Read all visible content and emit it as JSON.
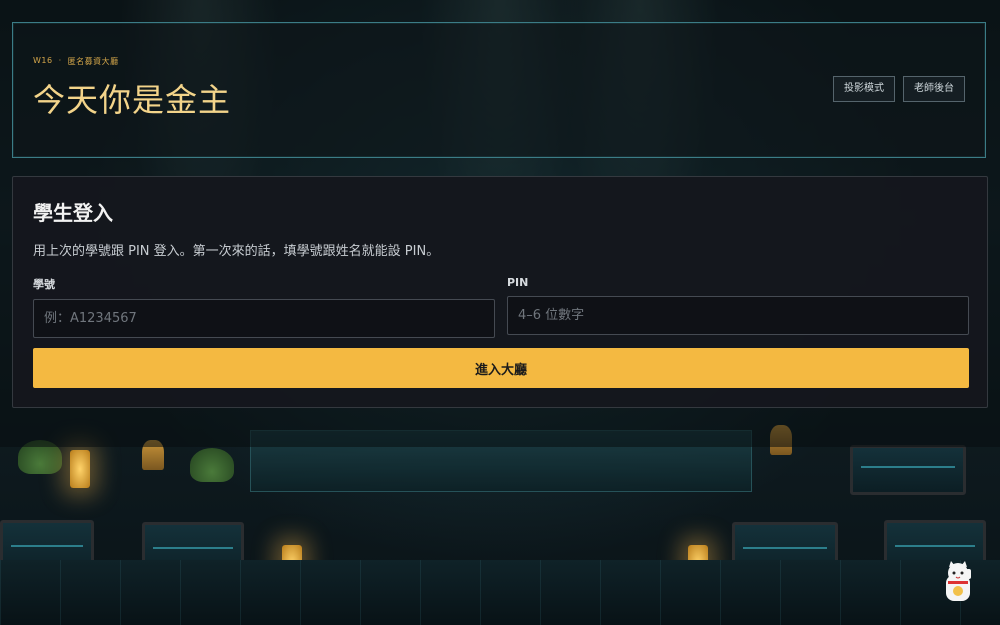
{
  "header": {
    "week": "W16",
    "separator": "·",
    "event": "匿名募資大廳",
    "title": "今天你是金主",
    "buttons": {
      "projection": "投影模式",
      "teacher": "老師後台"
    }
  },
  "login": {
    "title": "學生登入",
    "description": "用上次的學號跟 PIN 登入。第一次來的話，填學號跟姓名就能設 PIN。",
    "student_id": {
      "label": "學號",
      "placeholder": "例：A1234567"
    },
    "pin": {
      "label": "PIN",
      "placeholder": "4–6 位數字"
    },
    "submit_label": "進入大廳"
  },
  "colors": {
    "accent": "#f4b941",
    "title_gold": "#f3d48a",
    "frame_teal": "#3b7c86",
    "card_bg": "#15171d"
  },
  "icons": {
    "mascot": "lucky-cat-icon"
  }
}
